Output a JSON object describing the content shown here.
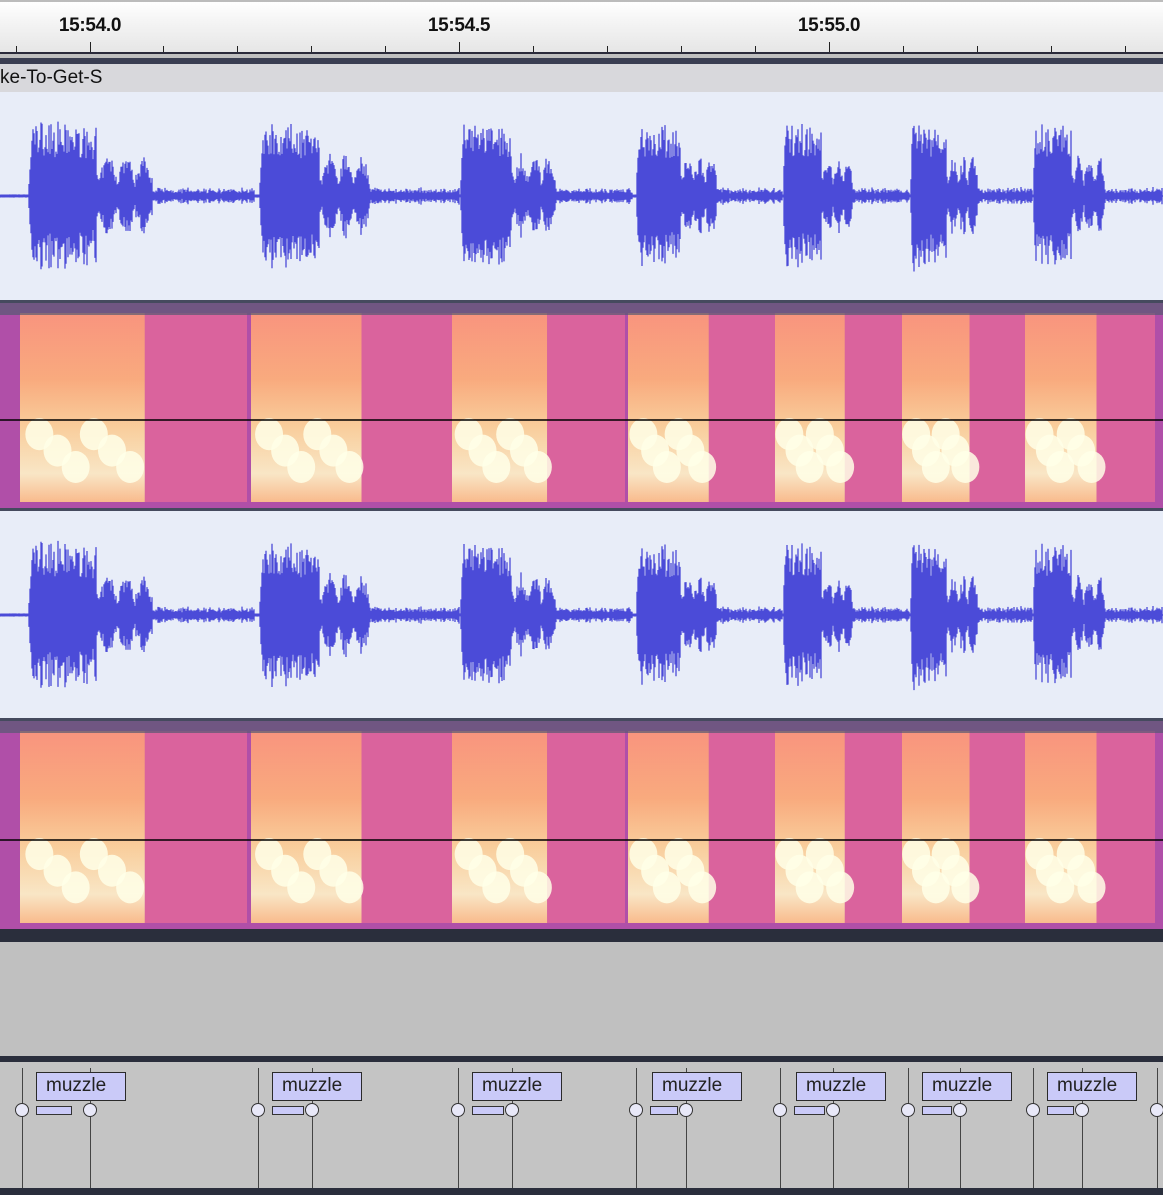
{
  "timeline": {
    "ticks": [
      {
        "label": "15:54.0",
        "t": 0.0
      },
      {
        "label": "15:54.5",
        "t": 0.5
      },
      {
        "label": "15:55.0",
        "t": 1.0
      }
    ]
  },
  "clip": {
    "title": "ke-To-Get-S"
  },
  "colors": {
    "waveform": "#4b4bd8",
    "waveform_bg": "#e8edf8",
    "label_fill": "#cacaf8"
  },
  "label_track": {
    "labels": [
      {
        "text": "muzzle"
      },
      {
        "text": "muzzle"
      },
      {
        "text": "muzzle"
      },
      {
        "text": "muzzle"
      },
      {
        "text": "muzzle"
      },
      {
        "text": "muzzle"
      },
      {
        "text": "muzzle"
      }
    ]
  }
}
